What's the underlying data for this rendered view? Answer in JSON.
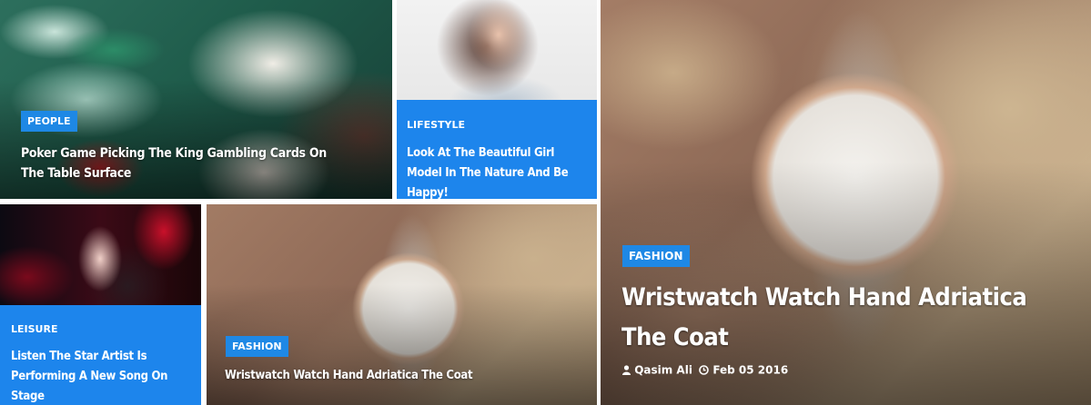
{
  "featured": [
    {
      "category": "People",
      "title": "Poker Game Picking The King Gambling Cards On The Table Surface"
    },
    {
      "category": "Lifestyle",
      "title": "Look At The Beautiful Girl Model In The Nature And Be Happy!"
    },
    {
      "category": "Leisure",
      "title": "Listen The Star Artist Is Performing A New Song On Stage"
    },
    {
      "category": "Fashion",
      "title": "Wristwatch Watch Hand Adriatica The Coat"
    },
    {
      "category": "Fashion",
      "title": "Wristwatch Watch Hand Adriatica The Coat",
      "author": "Qasim Ali",
      "date": "Feb 05 2016"
    }
  ],
  "colors": {
    "badge": "#1e88e5",
    "panel": "#1d85ec"
  },
  "icons": {
    "author": "user-icon",
    "date": "clock-icon"
  }
}
